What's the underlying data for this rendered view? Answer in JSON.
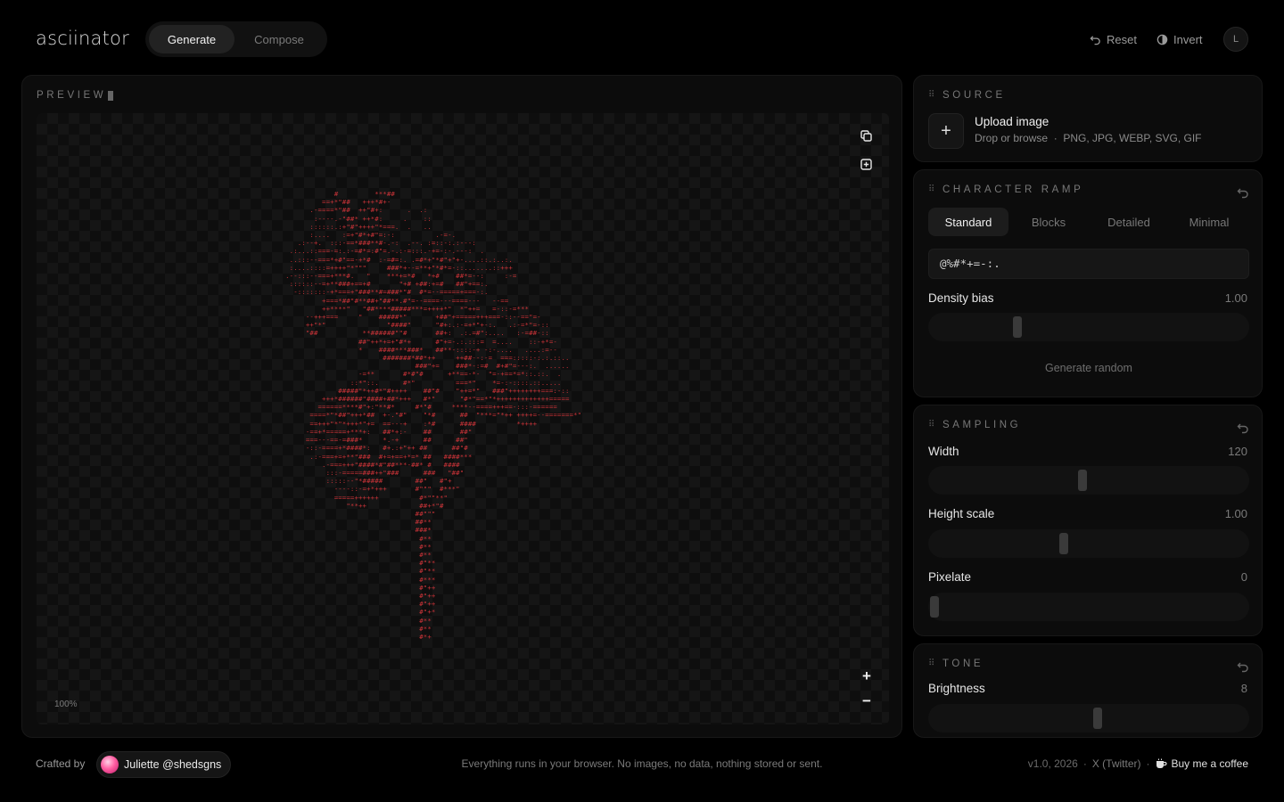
{
  "app": {
    "name": "asciinator"
  },
  "mode_tabs": [
    {
      "label": "Generate",
      "active": true
    },
    {
      "label": "Compose",
      "active": false
    }
  ],
  "header_actions": {
    "reset_label": "Reset",
    "invert_label": "Invert",
    "avatar_initial": "L"
  },
  "preview": {
    "label": "PREVIEW",
    "zoom": "100%",
    "ascii_art_colors": {
      "primary": "#c93338",
      "secondary": "#7a7070"
    }
  },
  "source": {
    "label": "SOURCE",
    "upload_title": "Upload image",
    "upload_sub": "Drop or browse  ·  PNG, JPG, WEBP, SVG, GIF"
  },
  "character_ramp": {
    "label": "CHARACTER RAMP",
    "tabs": [
      {
        "label": "Standard",
        "active": true
      },
      {
        "label": "Blocks",
        "active": false
      },
      {
        "label": "Detailed",
        "active": false
      },
      {
        "label": "Minimal",
        "active": false
      }
    ],
    "ramp_value": "@%#*+=-:.",
    "density_bias": {
      "label": "Density bias",
      "value": "1.00",
      "fraction": 0.27
    },
    "generate_random": "Generate random"
  },
  "sampling": {
    "label": "SAMPLING",
    "width": {
      "label": "Width",
      "value": "120",
      "fraction": 0.48
    },
    "height_scale": {
      "label": "Height scale",
      "value": "1.00",
      "fraction": 0.42
    },
    "pixelate": {
      "label": "Pixelate",
      "value": "0",
      "fraction": 0.0
    }
  },
  "tone": {
    "label": "TONE",
    "brightness": {
      "label": "Brightness",
      "value": "8",
      "fraction": 0.53
    }
  },
  "footer": {
    "crafted_by": "Crafted by",
    "author": "Juliette @shedsgns",
    "privacy": "Everything runs in your browser. No images, no data, nothing stored or sent.",
    "version": "v1.0, 2026",
    "twitter": "X (Twitter)",
    "coffee": "Buy me a coffee"
  }
}
